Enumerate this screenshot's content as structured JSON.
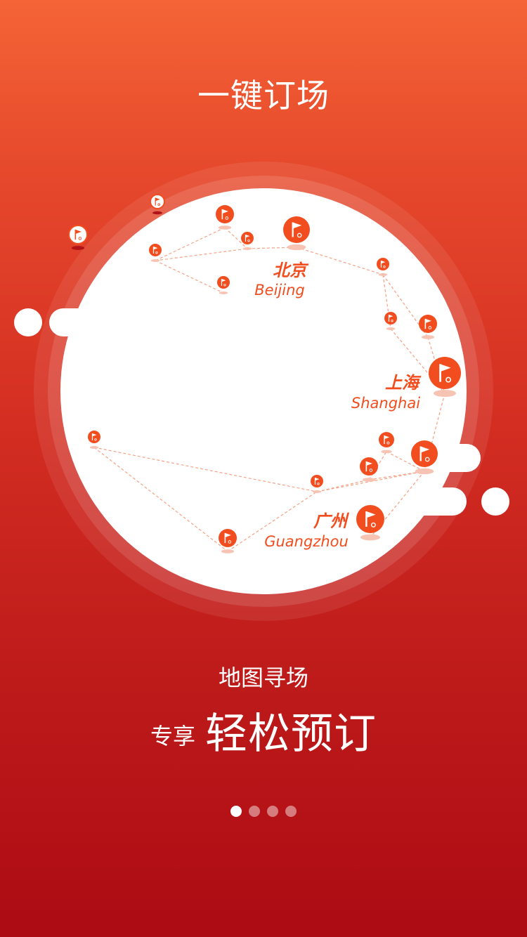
{
  "title": "一键订场",
  "subtitle": "地图寻场",
  "headline": {
    "prefix": "专享",
    "main": "轻松预订"
  },
  "cities": {
    "beijing": {
      "zh": "北京",
      "en": "Beijing"
    },
    "shanghai": {
      "zh": "上海",
      "en": "Shanghai"
    },
    "guangzhou": {
      "zh": "广州",
      "en": "Guangzhou"
    }
  },
  "pager": {
    "count": 4,
    "active_index": 0
  },
  "colors": {
    "accent": "#f24d1e",
    "route": "#f6a184",
    "bg_top": "#f46436",
    "bg_bottom": "#ad0b14"
  },
  "icons": [
    "golf-flag-pin-icon"
  ]
}
